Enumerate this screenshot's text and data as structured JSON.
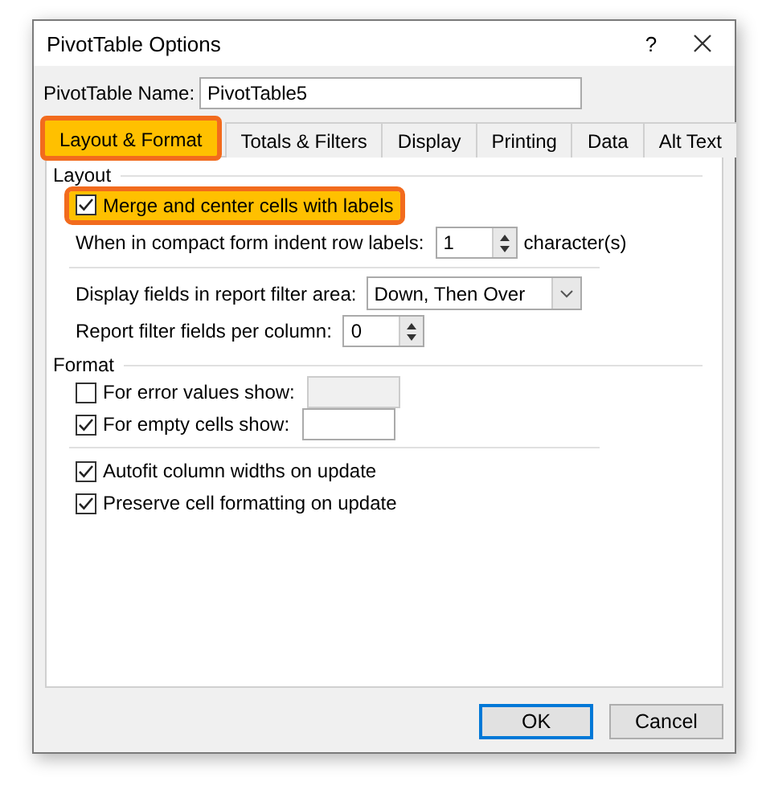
{
  "window": {
    "title": "PivotTable Options",
    "help": "?"
  },
  "name_field": {
    "label": "PivotTable Name:",
    "value": "PivotTable5"
  },
  "tabs": [
    {
      "label": "Layout & Format",
      "selected": true,
      "highlighted": true
    },
    {
      "label": "Totals & Filters",
      "selected": false,
      "highlighted": false
    },
    {
      "label": "Display",
      "selected": false,
      "highlighted": false
    },
    {
      "label": "Printing",
      "selected": false,
      "highlighted": false
    },
    {
      "label": "Data",
      "selected": false,
      "highlighted": false
    },
    {
      "label": "Alt Text",
      "selected": false,
      "highlighted": false
    }
  ],
  "layout_section": {
    "title": "Layout",
    "merge_center": {
      "label": "Merge and center cells with labels",
      "checked": true,
      "highlighted": true
    },
    "indent": {
      "label": "When in compact form indent row labels:",
      "value": "1",
      "suffix": "character(s)"
    },
    "filter_area": {
      "label": "Display fields in report filter area:",
      "value": "Down, Then Over"
    },
    "filter_per_column": {
      "label": "Report filter fields per column:",
      "value": "0"
    }
  },
  "format_section": {
    "title": "Format",
    "rows": [
      {
        "kind": "check_field",
        "label": "For error values show:",
        "checked": false
      },
      {
        "kind": "check_field",
        "label": "For empty cells show:",
        "checked": true
      },
      {
        "kind": "check",
        "label": "Autofit column widths on update",
        "checked": true
      },
      {
        "kind": "check",
        "label": "Preserve cell formatting on update",
        "checked": true
      }
    ]
  },
  "buttons": [
    {
      "label": "OK",
      "default": true
    },
    {
      "label": "Cancel",
      "default": false
    }
  ]
}
